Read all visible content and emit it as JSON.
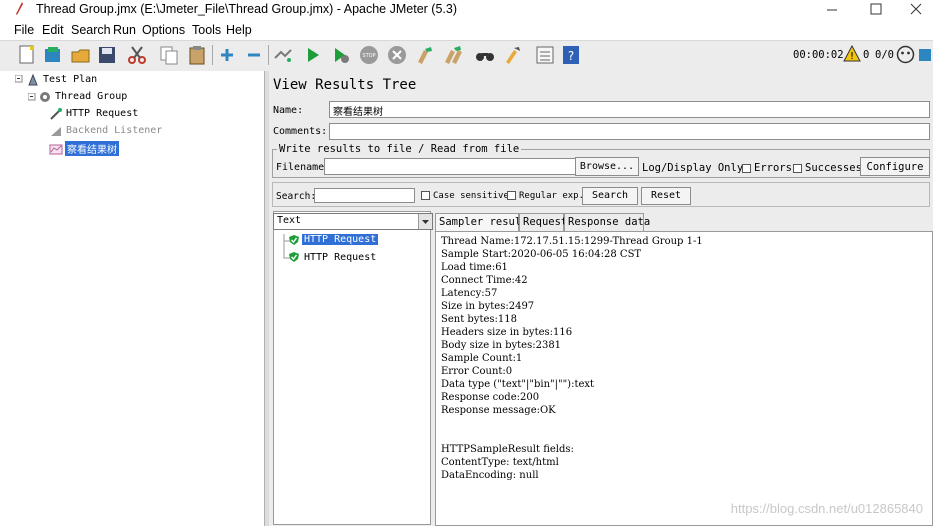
{
  "window": {
    "title": "Thread Group.jmx (E:\\Jmeter_File\\Thread Group.jmx) - Apache JMeter (5.3)"
  },
  "menu": {
    "file": "File",
    "edit": "Edit",
    "search": "Search",
    "run": "Run",
    "options": "Options",
    "tools": "Tools",
    "help": "Help"
  },
  "toolbar": {
    "elapsed": "00:00:02",
    "warning_count": "0",
    "threads": "0/0",
    "icons": [
      "new-icon",
      "templates-icon",
      "open-icon",
      "save-icon",
      "cut-icon",
      "copy-icon",
      "paste-icon",
      "expand-icon",
      "collapse-icon",
      "toggle-icon",
      "start-icon",
      "start-no-pause-icon",
      "stop-icon",
      "shutdown-icon",
      "clear-icon",
      "clear-all-icon",
      "search-icon",
      "reset-search-icon",
      "function-helper-icon",
      "help-icon"
    ]
  },
  "tree": {
    "test_plan": "Test Plan",
    "thread_group": "Thread Group",
    "http_request": "HTTP Request",
    "backend_listener": "Backend Listener",
    "view_results": "察看结果树"
  },
  "panel": {
    "title": "View Results Tree",
    "name_label": "Name:",
    "name_value": "察看结果树",
    "comments_label": "Comments:",
    "comments_value": "",
    "file_group": "Write results to file / Read from file",
    "filename_label": "Filename",
    "filename_value": "",
    "browse": "Browse...",
    "log_display": "Log/Display Only:",
    "errors": "Errors",
    "successes": "Successes",
    "configure": "Configure",
    "search_label": "Search:",
    "search_value": "",
    "case_sensitive": "Case sensitive",
    "regular_exp": "Regular exp.",
    "search_button": "Search",
    "reset_button": "Reset",
    "renderer": "Text"
  },
  "results": [
    {
      "label": "HTTP Request",
      "status": "success",
      "selected": true
    },
    {
      "label": "HTTP Request",
      "status": "success",
      "selected": false
    }
  ],
  "tabs": {
    "sampler_result": "Sampler result",
    "request": "Request",
    "response_data": "Response data"
  },
  "detail": {
    "lines": [
      "Thread Name:172.17.51.15:1299-Thread Group 1-1",
      "Sample Start:2020-06-05 16:04:28 CST",
      "Load time:61",
      "Connect Time:42",
      "Latency:57",
      "Size in bytes:2497",
      "Sent bytes:118",
      "Headers size in bytes:116",
      "Body size in bytes:2381",
      "Sample Count:1",
      "Error Count:0",
      "Data type (\"text\"|\"bin\"|\"\"):text",
      "Response code:200",
      "Response message:OK",
      "",
      "",
      "HTTPSampleResult fields:",
      "ContentType: text/html",
      "DataEncoding: null"
    ]
  },
  "watermark": "https://blog.csdn.net/u012865840"
}
